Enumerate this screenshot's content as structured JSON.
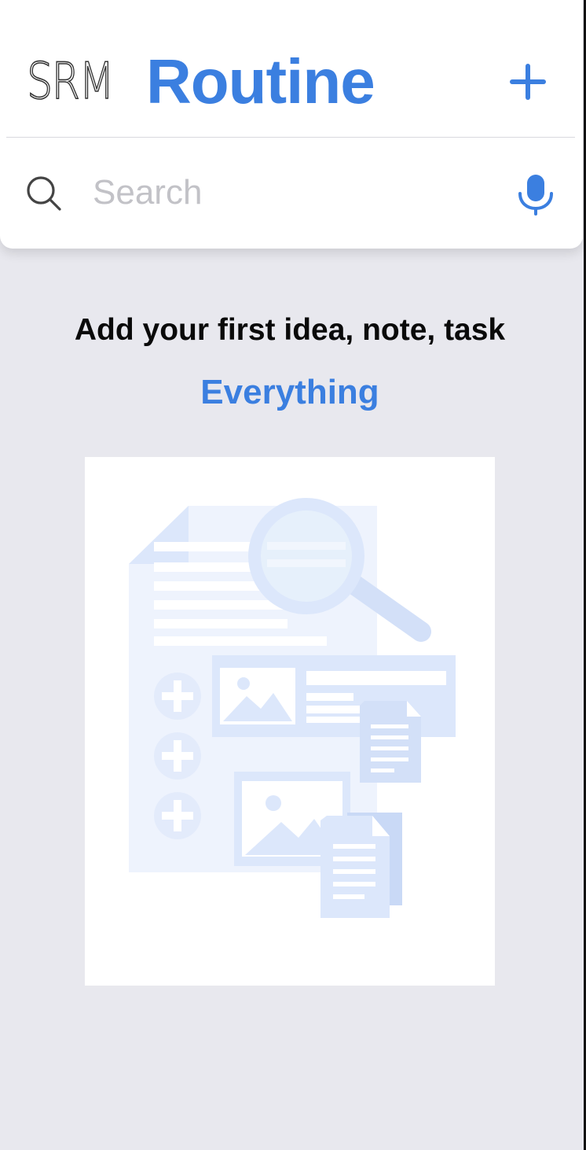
{
  "header": {
    "brand_mark": "SRM",
    "title": "Routine",
    "add_button_icon": "plus-icon"
  },
  "search": {
    "placeholder": "Search",
    "value": "",
    "search_icon": "search-icon",
    "mic_icon": "microphone-icon"
  },
  "empty_state": {
    "title": "Add your first idea, note, task",
    "subtitle": "Everything",
    "illustration": "document-search-illustration"
  },
  "colors": {
    "accent": "#3b7fe0",
    "background": "#e8e8ee",
    "card": "#ffffff",
    "placeholder": "#c2c2c7",
    "illustration_tint": "#dce7fb"
  }
}
